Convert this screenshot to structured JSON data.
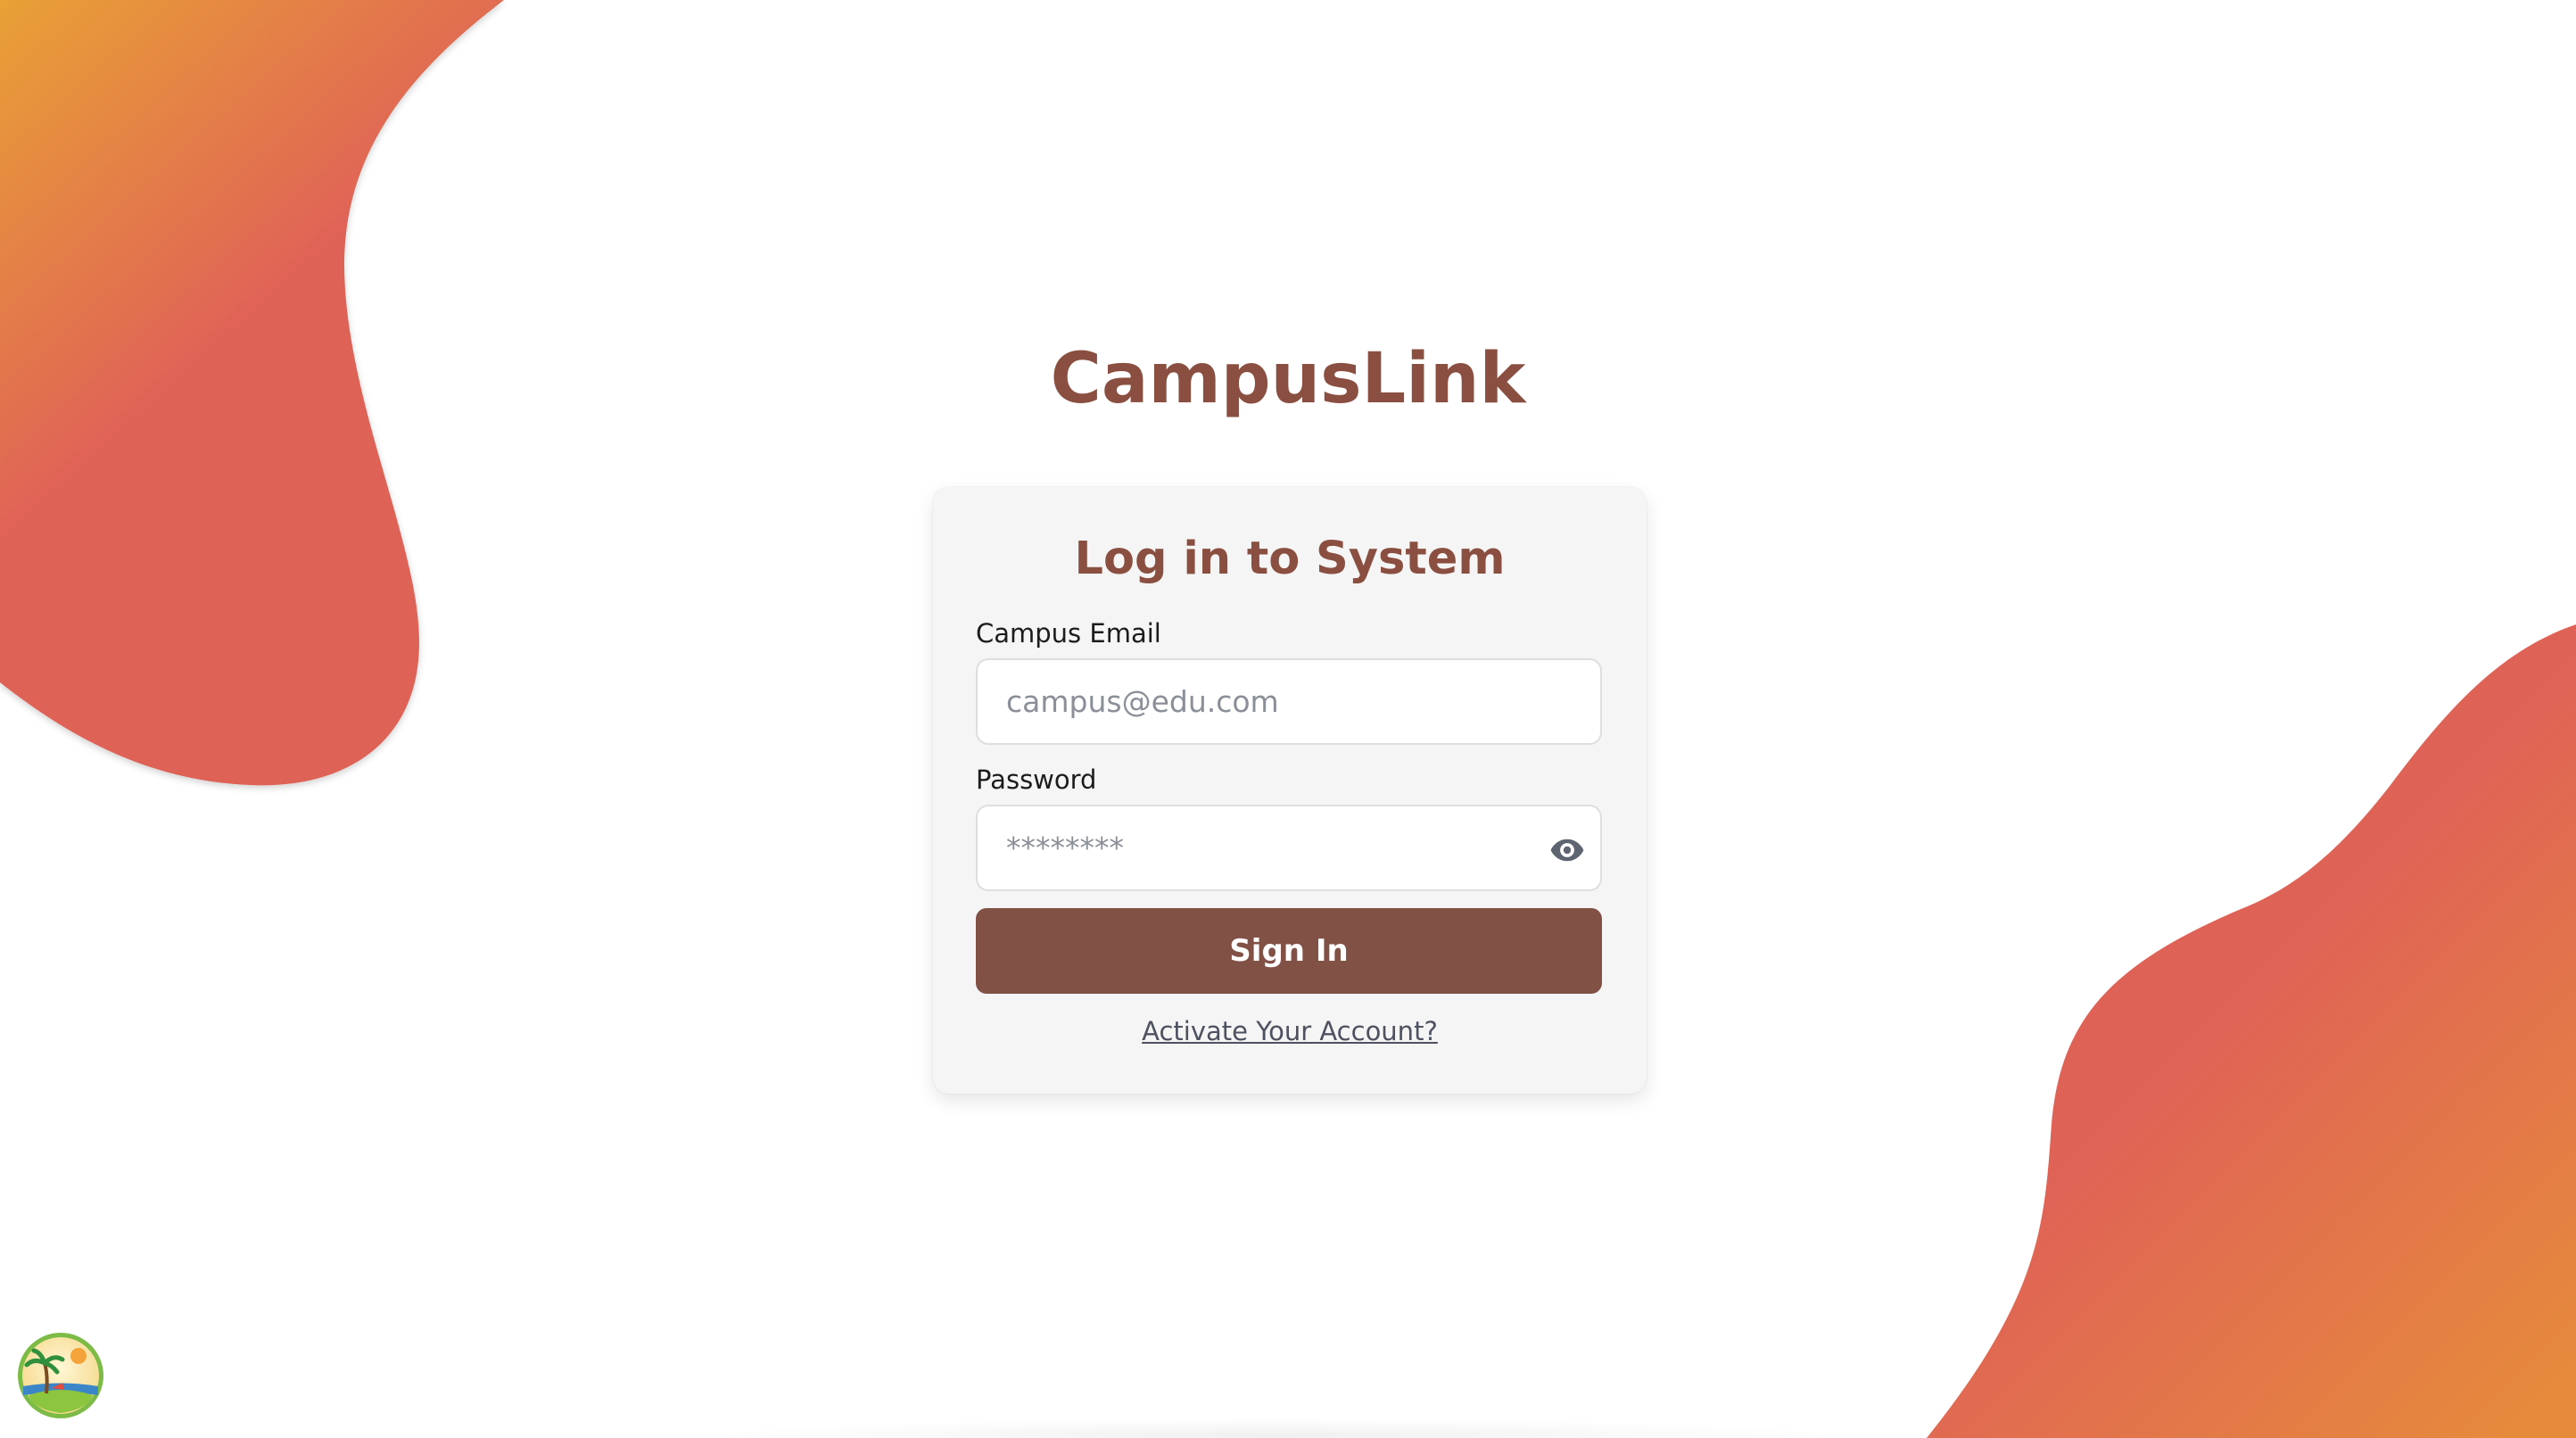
{
  "app": {
    "brand_name": "CampusLink"
  },
  "login_card": {
    "title": "Log in to System",
    "email": {
      "label": "Campus Email",
      "placeholder": "campus@edu.com",
      "value": ""
    },
    "password": {
      "label": "Password",
      "placeholder": "********",
      "value": "",
      "toggle_icon": "eye-icon"
    },
    "submit_label": "Sign In",
    "activate_link": "Activate Your Account?"
  },
  "decor": {
    "top_left_blob_icon": "gradient-blob",
    "bottom_right_blob_icon": "gradient-blob",
    "corner_logo_icon": "palm-tree-island-icon"
  },
  "colors": {
    "brand": "#8a4f40",
    "button": "#815146",
    "card_background": "#f5f5f5",
    "gradient_orange": "#e9a135",
    "gradient_red": "#df6257",
    "link": "#4d5160"
  }
}
